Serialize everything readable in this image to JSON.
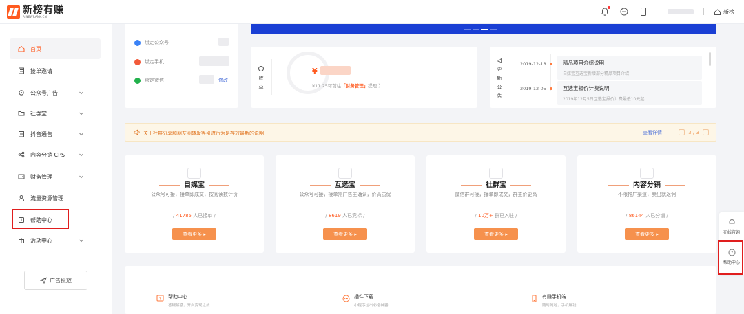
{
  "header": {
    "logo_name": "新榜有赚",
    "logo_sub": "A.NEWRANK.CN",
    "new_label": "新榜"
  },
  "sidebar": {
    "items": [
      {
        "label": "首页",
        "icon": "home-icon"
      },
      {
        "label": "接单邀请",
        "icon": "document-icon"
      },
      {
        "label": "公众号广告",
        "icon": "gear-icon"
      },
      {
        "label": "社群宝",
        "icon": "folder-icon"
      },
      {
        "label": "抖音通告",
        "icon": "clipboard-icon"
      },
      {
        "label": "内容分销 CPS",
        "icon": "share-icon"
      },
      {
        "label": "财务管理",
        "icon": "wallet-icon"
      },
      {
        "label": "流量资源管理",
        "icon": "user-icon"
      },
      {
        "label": "帮助中心",
        "icon": "info-icon"
      },
      {
        "label": "活动中心",
        "icon": "gift-icon"
      }
    ],
    "ad_button": "广告投放"
  },
  "account": {
    "wechat_official": "绑定公众号",
    "phone": "绑定手机",
    "wechat": "绑定微信",
    "edit": "修改"
  },
  "income": {
    "label": "收益",
    "currency": "¥",
    "hint_prefix": "¥11.25可前往",
    "hint_link": "「财务管理」",
    "hint_suffix": "提现 〉"
  },
  "announcements": {
    "label": "更新公告",
    "items": [
      {
        "date": "2019-12-18",
        "title": "精品项目介绍说明",
        "desc": "自媒宝互选宝新增部分精品项目介绍"
      },
      {
        "date": "2019-12-05",
        "title": "互选宝报价计费说明",
        "desc": "2019年12月5日互选宝报价计费最低10元起"
      }
    ]
  },
  "notice": {
    "text": "关于社群分享和朋友圈转发等引流行为是存放最新的说明",
    "more": "查看详情",
    "page": "3 / 3"
  },
  "products": [
    {
      "title": "自媒宝",
      "desc": "公众号可接，接单即成交，按阅读数计价",
      "count": "41785",
      "count_suffix": "人已接单",
      "button": "查看更多 ▸"
    },
    {
      "title": "互选宝",
      "desc": "公众号可接，接单需广告主确认，价高质优",
      "count": "8619",
      "count_suffix": "人已竞标",
      "button": "查看更多 ▸"
    },
    {
      "title": "社群宝",
      "desc": "微信群可接，接单即成交，群主价更高",
      "count": "10万+",
      "count_suffix": "群已入驻",
      "button": "查看更多 ▸"
    },
    {
      "title": "内容分销",
      "desc": "不限推广渠道，卖出就返佣",
      "count": "86144",
      "count_suffix": "人已分销",
      "button": "查看更多 ▸"
    }
  ],
  "bottom": [
    {
      "title": "帮助中心",
      "sub": "答疑解惑，开启变现之旅"
    },
    {
      "title": "插件下载",
      "sub": "小程序拉出必备神器"
    },
    {
      "title": "有赚手机端",
      "sub": "随时随地，手机赚钱"
    }
  ],
  "float_panel": {
    "consult": "在线咨询",
    "help": "帮助中心"
  },
  "colors": {
    "accent": "#ff5a1f",
    "button": "#f6914d",
    "banner": "#1a3fd4",
    "highlight": "#e01e1e"
  }
}
